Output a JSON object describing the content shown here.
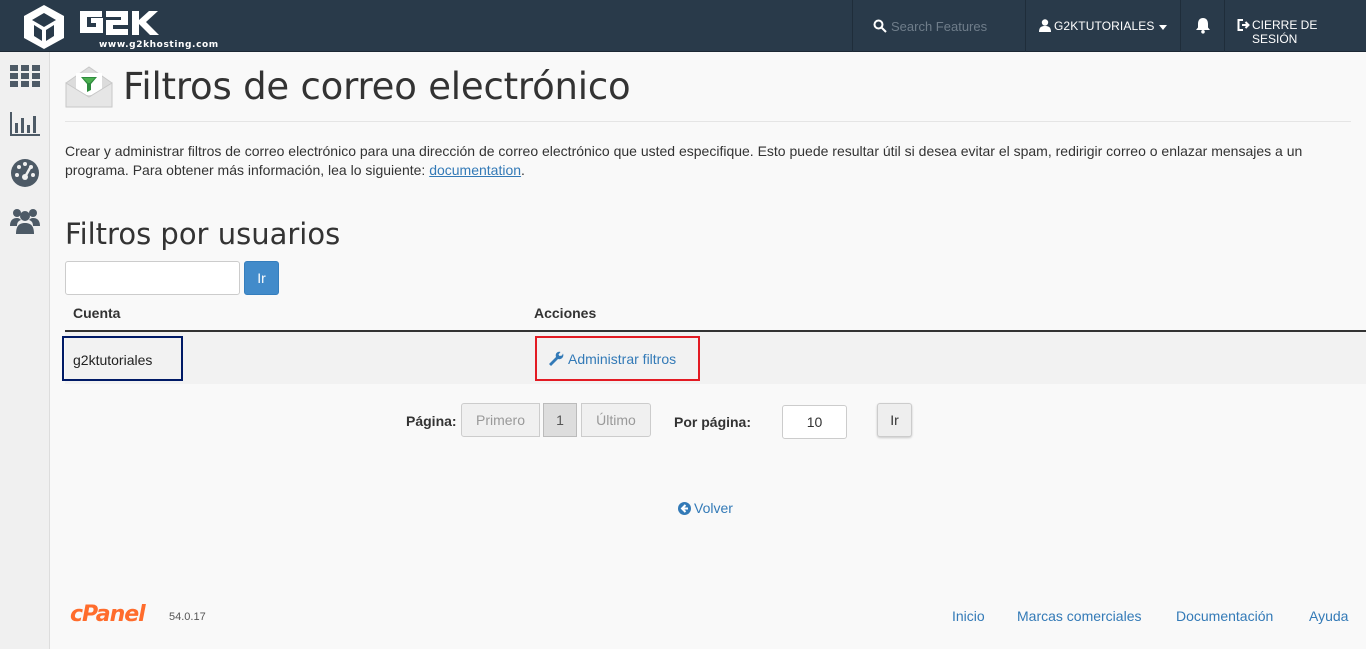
{
  "brand": {
    "logo_text": "G2K",
    "logo_url": "www.g2khosting.com"
  },
  "topbar": {
    "search_placeholder": "Search Features",
    "user_label": "G2KTUTORIALES",
    "logout_label": "CIERRE DE SESIÓN"
  },
  "page": {
    "title": "Filtros de correo electrónico",
    "description": "Crear y administrar filtros de correo electrónico para una dirección de correo electrónico que usted especifique. Esto puede resultar útil si desea evitar el spam, redirigir correo o enlazar mensajes a un programa. Para obtener más información, lea lo siguiente: ",
    "doc_link": "documentation",
    "desc_end": "."
  },
  "filters": {
    "section_title": "Filtros por usuarios",
    "search_value": "",
    "go_label": "Ir",
    "columns": [
      "Cuenta",
      "Acciones"
    ],
    "rows": [
      {
        "account": "g2ktutoriales",
        "action": "Administrar filtros"
      }
    ]
  },
  "pagination": {
    "page_label": "Página:",
    "first": "Primero",
    "current": "1",
    "last": "Último",
    "per_page_label": "Por página:",
    "per_page_value": "10",
    "go_label": "Ir"
  },
  "back_label": "Volver",
  "footer": {
    "logo": "cPanel",
    "version": "54.0.17",
    "links": [
      "Inicio",
      "Marcas comerciales",
      "Documentación",
      "Ayuda"
    ]
  },
  "colors": {
    "topbar": "#293a4a",
    "primary": "#428bca",
    "link": "#337ab7",
    "highlight_red": "#e31b23",
    "highlight_navy": "#001a66",
    "cpanel_orange": "#ff6c2c"
  }
}
